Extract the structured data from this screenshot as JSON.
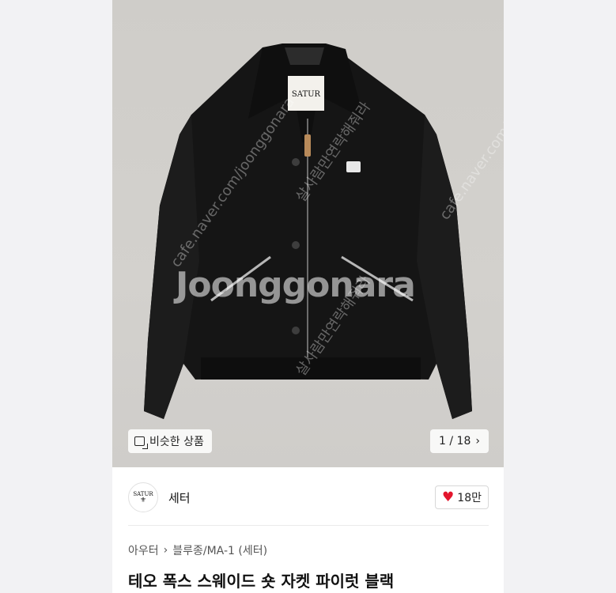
{
  "photo": {
    "watermark": "Joonggonara",
    "diag_watermarks": [
      "cafe.naver.com/joonggonara",
      "살사람만연락해줘라",
      "cafe.naver.com/joonggonara",
      "살사람만연락해줘라"
    ],
    "label_tag": "SATUR",
    "similar_label": "비슷한 상품",
    "counter": "1 / 18",
    "counter_icon": "chevron-right-icon"
  },
  "seller": {
    "logo_text": "SATUR",
    "name": "세터",
    "likes": "18만"
  },
  "breadcrumb": {
    "items": [
      "아우터",
      "블루종/MA-1 (세터)"
    ],
    "separator": "›"
  },
  "product": {
    "title": "테오 폭스 스웨이드 숏 자켓 파이럿 블랙"
  },
  "colors": {
    "like_heart": "#e3162d",
    "background": "#f2f2f4"
  }
}
